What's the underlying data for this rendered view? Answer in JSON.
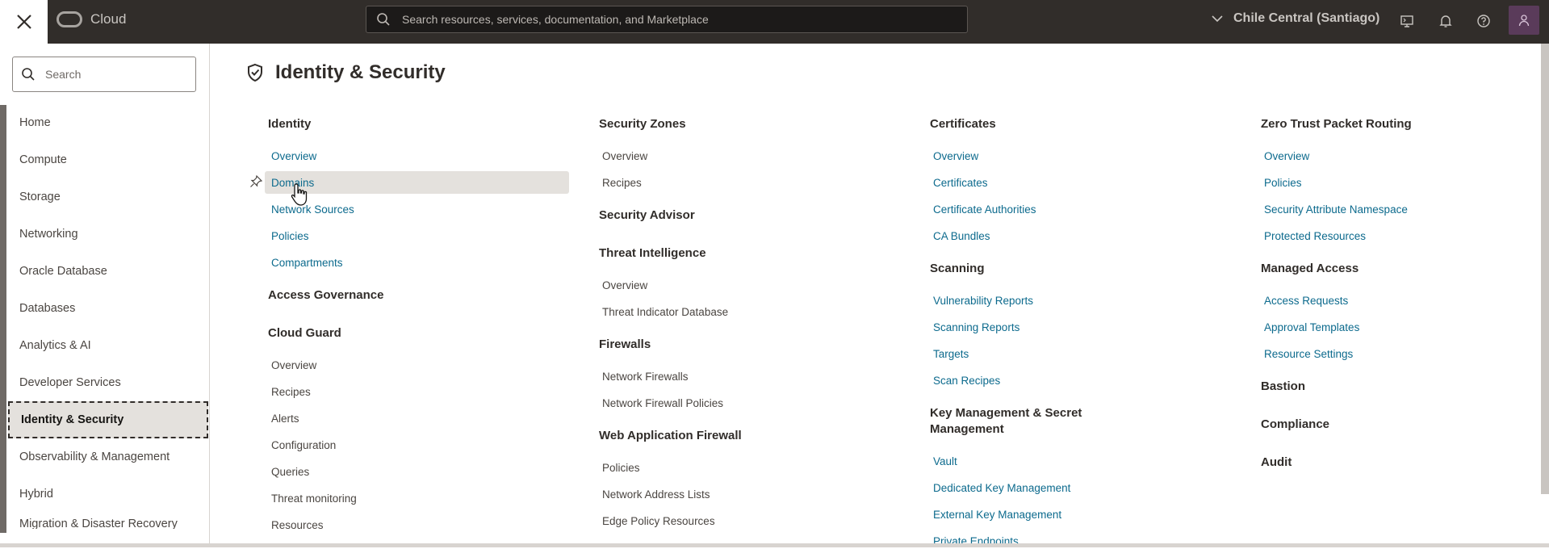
{
  "topbar": {
    "brand": "Cloud",
    "search_placeholder": "Search resources, services, documentation, and Marketplace",
    "region": "Chile Central (Santiago)"
  },
  "sidebar": {
    "search_placeholder": "Search",
    "items": [
      "Home",
      "Compute",
      "Storage",
      "Networking",
      "Oracle Database",
      "Databases",
      "Analytics & AI",
      "Developer Services",
      "Identity & Security",
      "Observability & Management",
      "Hybrid",
      "Migration & Disaster Recovery"
    ],
    "active": "Identity & Security"
  },
  "main": {
    "title": "Identity & Security",
    "col1": {
      "identity": {
        "heading": "Identity",
        "links": [
          "Overview",
          "Domains",
          "Network Sources",
          "Policies",
          "Compartments"
        ]
      },
      "access_governance": "Access Governance",
      "cloud_guard": {
        "heading": "Cloud Guard",
        "links": [
          "Overview",
          "Recipes",
          "Alerts",
          "Configuration",
          "Queries",
          "Threat monitoring",
          "Resources"
        ]
      }
    },
    "col2": {
      "security_zones": {
        "heading": "Security Zones",
        "links": [
          "Overview",
          "Recipes"
        ]
      },
      "security_advisor": "Security Advisor",
      "threat_intelligence": {
        "heading": "Threat Intelligence",
        "links": [
          "Overview",
          "Threat Indicator Database"
        ]
      },
      "firewalls": {
        "heading": "Firewalls",
        "links": [
          "Network Firewalls",
          "Network Firewall Policies"
        ]
      },
      "waf": {
        "heading": "Web Application Firewall",
        "links": [
          "Policies",
          "Network Address Lists",
          "Edge Policy Resources"
        ]
      }
    },
    "col3": {
      "certificates": {
        "heading": "Certificates",
        "links": [
          "Overview",
          "Certificates",
          "Certificate Authorities",
          "CA Bundles"
        ]
      },
      "scanning": {
        "heading": "Scanning",
        "links": [
          "Vulnerability Reports",
          "Scanning Reports",
          "Targets",
          "Scan Recipes"
        ]
      },
      "kms": {
        "heading_line1": "Key Management & Secret",
        "heading_line2": "Management",
        "links": [
          "Vault",
          "Dedicated Key Management",
          "External Key Management",
          "Private Endpoints"
        ]
      }
    },
    "col4": {
      "zpr": {
        "heading": "Zero Trust Packet Routing",
        "links": [
          "Overview",
          "Policies",
          "Security Attribute Namespace",
          "Protected Resources"
        ]
      },
      "managed_access": {
        "heading": "Managed Access",
        "links": [
          "Access Requests",
          "Approval Templates",
          "Resource Settings"
        ]
      },
      "bastion": "Bastion",
      "compliance": "Compliance",
      "audit": "Audit"
    }
  }
}
